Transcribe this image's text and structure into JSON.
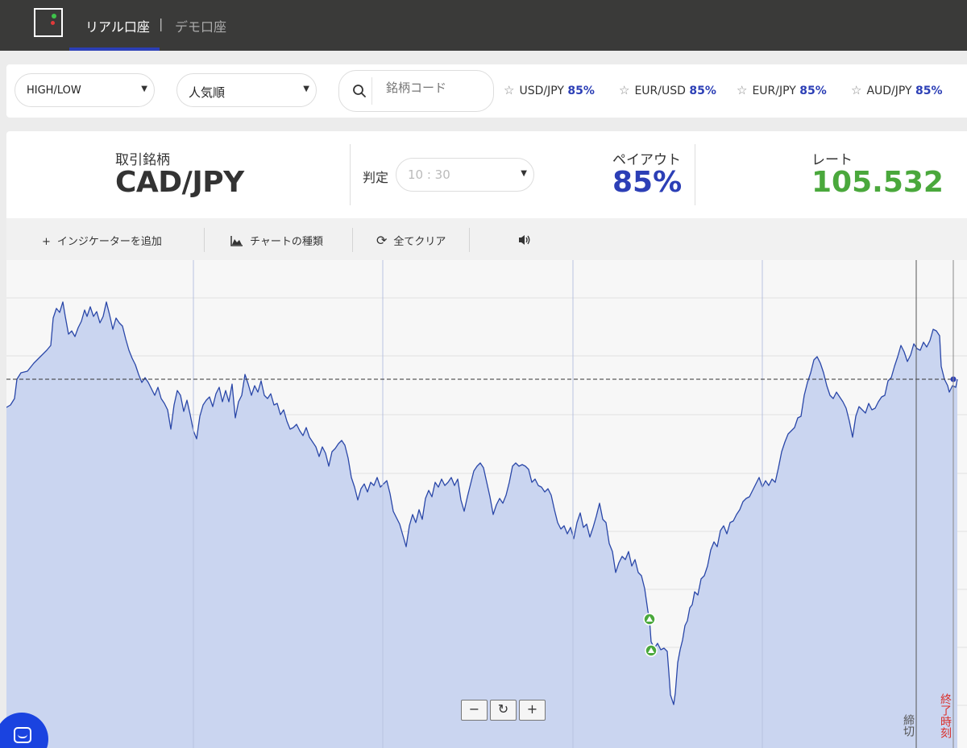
{
  "header": {
    "accounts": [
      {
        "label": "リアル口座",
        "active": true
      },
      {
        "label": "デモ口座",
        "active": false
      }
    ],
    "separator": "|"
  },
  "filters": {
    "option_type": "HIGH/LOW",
    "sort_order": "人気順",
    "search_placeholder": "銘柄コード"
  },
  "favorites": [
    {
      "pair": "USD/JPY",
      "payout": "85%"
    },
    {
      "pair": "EUR/USD",
      "payout": "85%"
    },
    {
      "pair": "EUR/JPY",
      "payout": "85%"
    },
    {
      "pair": "AUD/JPY",
      "payout": "85%"
    }
  ],
  "asset_panel": {
    "asset_label": "取引銘柄",
    "asset_value": "CAD/JPY",
    "expiry_label": "判定",
    "expiry_value": "10 : 30",
    "payout_label": "ペイアウト",
    "payout_value": "85%",
    "rate_label": "レート",
    "rate_value": "105.532"
  },
  "toolbar": {
    "add_indicator": "インジケーターを追加",
    "chart_type": "チャートの種類",
    "clear_all": "全てクリア"
  },
  "chart": {
    "zoom_out": "−",
    "reset": "↻",
    "zoom_in": "+",
    "cutoff_label": "締切",
    "end_time_label": "終了時刻",
    "colors": {
      "line": "#2a47a8",
      "fill": "#cad5f0",
      "end_label": "#d9302c",
      "trade_marker": "#4aa83c",
      "current_rate_dot": "#2c3fb6"
    }
  },
  "icons": [
    "logo-icon",
    "search-icon",
    "star-icon",
    "plus-icon",
    "chart-type-icon",
    "refresh-icon",
    "volume-icon",
    "chat-icon",
    "high-arrow-icon"
  ]
}
